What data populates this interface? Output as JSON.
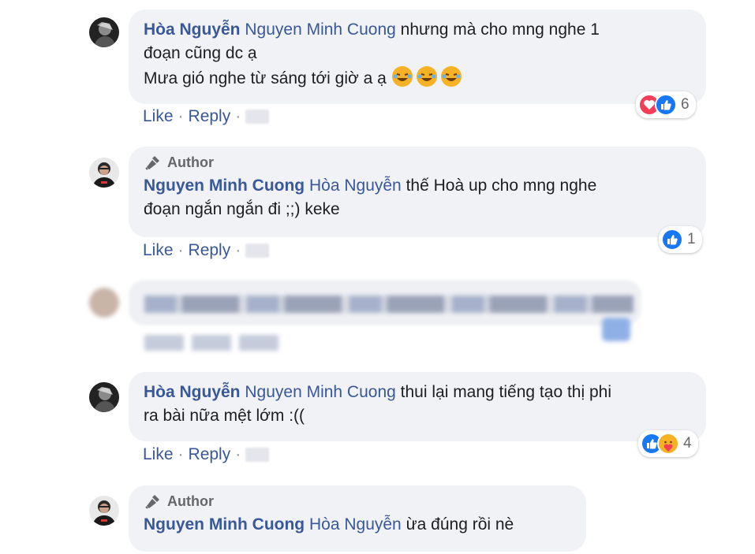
{
  "comments": [
    {
      "author": "Hòa Nguyễn",
      "tag": "Nguyen Minh Cuong",
      "text1": "nhưng mà cho mng nghe 1",
      "text2": "đoạn cũng dc ạ",
      "text3": "Mưa gió nghe từ sáng tới giờ a ạ",
      "emojis": [
        "rofl-emoji",
        "rofl-emoji",
        "rofl-emoji"
      ],
      "reactions": [
        "love",
        "like"
      ],
      "reaction_count": "6"
    },
    {
      "badge": "Author",
      "author": "Nguyen Minh Cuong",
      "tag": "Hòa Nguyễn",
      "text1": "thế Hoà up cho mng nghe",
      "text2": "đoạn ngắn ngắn đi ;;) keke",
      "reactions": [
        "like"
      ],
      "reaction_count": "1"
    },
    {
      "author": "Hòa Nguyễn",
      "tag": "Nguyen Minh Cuong",
      "text1": "thui lại mang tiếng tạo thị phi",
      "text2": "ra bài nữa mệt lớm :((",
      "reactions": [
        "like",
        "care"
      ],
      "reaction_count": "4"
    },
    {
      "badge": "Author",
      "author": "Nguyen Minh Cuong",
      "tag": "Hòa Nguyễn",
      "text1": "ừa đúng rồi nè"
    }
  ],
  "actions": {
    "like": "Like",
    "reply": "Reply",
    "sep": "·"
  },
  "colors": {
    "link": "#385898",
    "bubble": "#f0f2f5",
    "like": "#1877f2",
    "love": "#f33e58",
    "meta": "#65676b"
  }
}
